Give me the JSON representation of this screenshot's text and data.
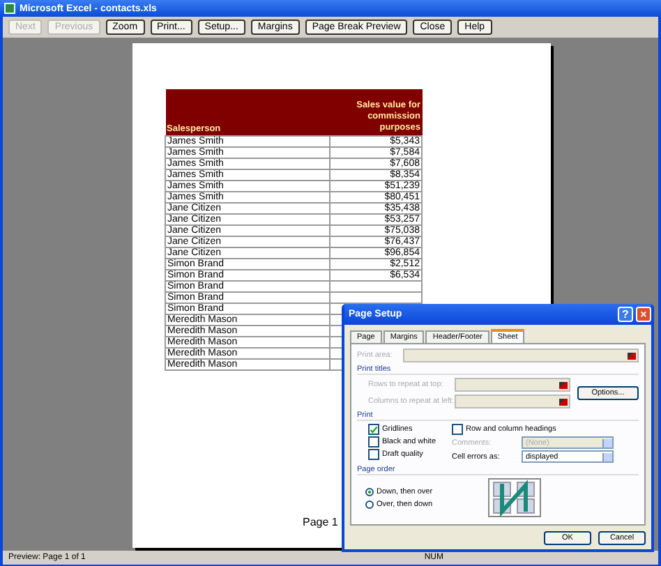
{
  "window": {
    "title": "Microsoft Excel - contacts.xls"
  },
  "toolbar": [
    {
      "label": "Next",
      "disabled": true
    },
    {
      "label": "Previous",
      "disabled": true
    },
    {
      "label": "Zoom",
      "disabled": false
    },
    {
      "label": "Print...",
      "disabled": false
    },
    {
      "label": "Setup...",
      "disabled": false
    },
    {
      "label": "Margins",
      "disabled": false
    },
    {
      "label": "Page Break Preview",
      "disabled": false
    },
    {
      "label": "Close",
      "disabled": false
    },
    {
      "label": "Help",
      "disabled": false
    }
  ],
  "sheet": {
    "columns": [
      "Salesperson",
      "Sales value for commission purposes"
    ],
    "rows": [
      {
        "name": "James Smith",
        "value": "$5,343"
      },
      {
        "name": "James Smith",
        "value": "$7,584"
      },
      {
        "name": "James Smith",
        "value": "$7,608"
      },
      {
        "name": "James Smith",
        "value": "$8,354"
      },
      {
        "name": "James Smith",
        "value": "$51,239"
      },
      {
        "name": "James Smith",
        "value": "$80,451"
      },
      {
        "name": "Jane Citizen",
        "value": "$35,438"
      },
      {
        "name": "Jane Citizen",
        "value": "$53,257"
      },
      {
        "name": "Jane Citizen",
        "value": "$75,038"
      },
      {
        "name": "Jane Citizen",
        "value": "$76,437"
      },
      {
        "name": "Jane Citizen",
        "value": "$96,854"
      },
      {
        "name": "Simon Brand",
        "value": "$2,512"
      },
      {
        "name": "Simon Brand",
        "value": "$6,534"
      },
      {
        "name": "Simon Brand"
      },
      {
        "name": "Simon Brand"
      },
      {
        "name": "Simon Brand"
      },
      {
        "name": "Meredith Mason"
      },
      {
        "name": "Meredith Mason"
      },
      {
        "name": "Meredith Mason"
      },
      {
        "name": "Meredith Mason"
      },
      {
        "name": "Meredith Mason"
      }
    ],
    "footer": "Page 1"
  },
  "dialog": {
    "title": "Page Setup",
    "help": "?",
    "close": "×",
    "tabs": [
      {
        "label": "Page",
        "selected": false
      },
      {
        "label": "Margins",
        "selected": false
      },
      {
        "label": "Header/Footer",
        "selected": false
      },
      {
        "label": "Sheet",
        "selected": true
      }
    ],
    "print_area": {
      "label": "Print area:",
      "disabled": true
    },
    "print_titles": {
      "heading": "Print titles",
      "fields": [
        {
          "label": "Rows to repeat at top:",
          "disabled": true
        },
        {
          "label": "Columns to repeat at left:",
          "disabled": true
        }
      ]
    },
    "options_button": "Options...",
    "print": {
      "heading": "Print",
      "checkboxes": [
        {
          "label": "Gridlines",
          "checked": true
        },
        {
          "label": "Black and white",
          "checked": false
        },
        {
          "label": "Draft quality",
          "checked": false
        }
      ],
      "headings_checkbox": {
        "label": "Row and column headings",
        "checked": false
      },
      "comments": {
        "label": "Comments:",
        "value": "(None)",
        "disabled": true
      },
      "cell_errors": {
        "label": "Cell errors as:",
        "value": "displayed",
        "disabled": false
      }
    },
    "page_order": {
      "heading": "Page order",
      "options": [
        {
          "label": "Down, then over",
          "selected": true
        },
        {
          "label": "Over, then down",
          "selected": false
        }
      ]
    },
    "buttons": [
      "OK",
      "Cancel"
    ]
  },
  "status_bar": {
    "text": "Preview: Page 1 of 1",
    "indicator": "NUM"
  }
}
